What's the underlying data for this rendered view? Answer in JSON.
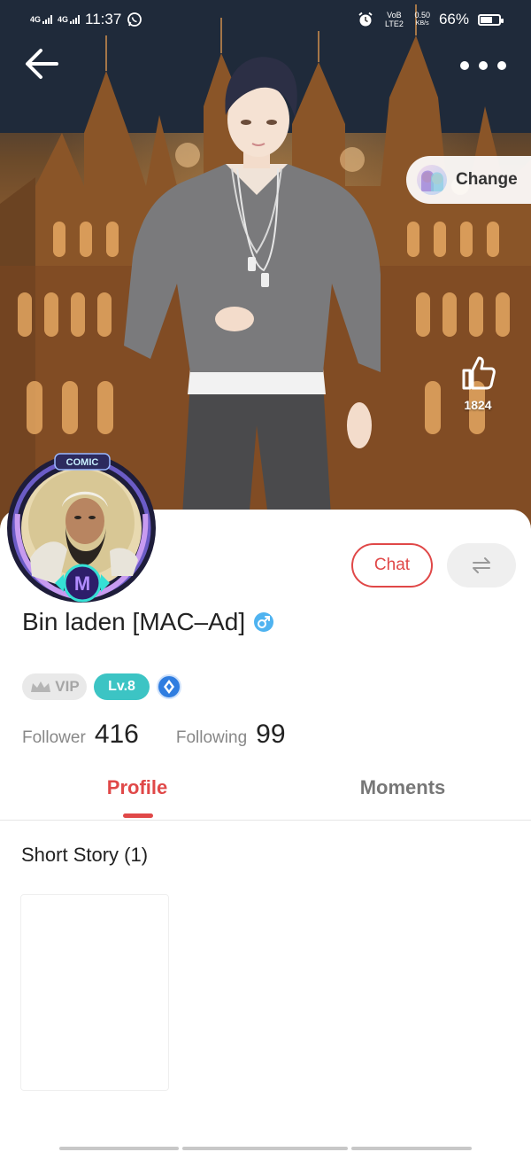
{
  "status_bar": {
    "network_1": "4G",
    "network_2": "4G",
    "time": "11:37",
    "volte": "VoB LTE2",
    "speed_value": "0.50",
    "speed_unit": "KB/s",
    "battery": "66%",
    "battery_level": 0.66,
    "icons": [
      "whatsapp-icon",
      "alarm-icon",
      "battery-icon"
    ]
  },
  "header": {
    "back_icon": "arrow-left-icon",
    "more_icon": "more-dots-icon"
  },
  "cover": {
    "change_label": "Change",
    "like_count": "1824",
    "like_icon": "thumbs-up-icon"
  },
  "avatar": {
    "frame_label": "COMIC",
    "frame_badge": "M"
  },
  "actions": {
    "chat_label": "Chat",
    "swap_icon": "swap-arrows-icon"
  },
  "user": {
    "name": "Bin laden [MAC–Ad]",
    "gender_icon": "male-icon"
  },
  "badges": {
    "vip_label": "VIP",
    "level_label": "Lv.8"
  },
  "stats": {
    "follower_label": "Follower",
    "follower_count": "416",
    "following_label": "Following",
    "following_count": "99"
  },
  "tabs": [
    {
      "label": "Profile",
      "active": true
    },
    {
      "label": "Moments",
      "active": false
    }
  ],
  "content": {
    "section_title": "Short Story (1)"
  },
  "colors": {
    "accent": "#e04848",
    "level": "#3cc4c4",
    "gender": "#4fb3f0",
    "gem": "#2f7de0"
  }
}
